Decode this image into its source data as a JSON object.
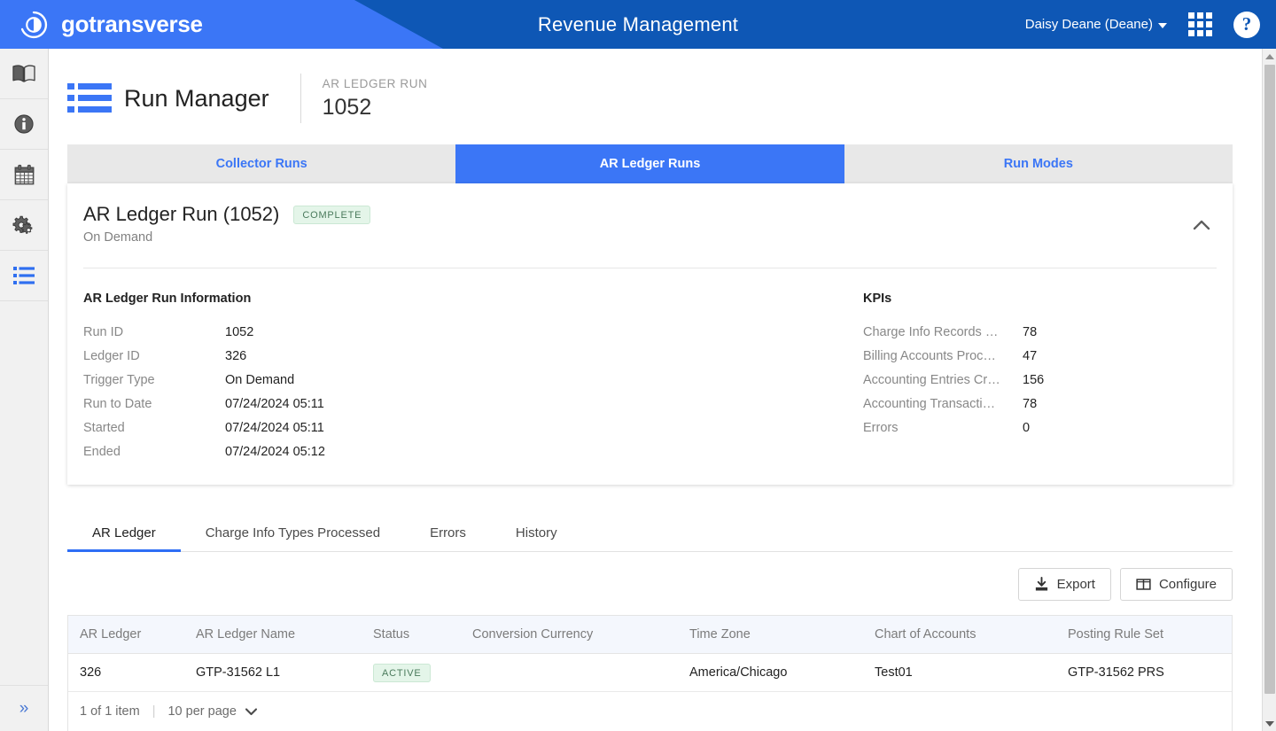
{
  "header": {
    "brand": "gotransverse",
    "app_title": "Revenue Management",
    "user": "Daisy Deane (Deane)",
    "apps_icon": "grid-apps-icon",
    "help_icon": "help-question-icon",
    "colors": {
      "light_blue": "#3b76f6",
      "dark_blue": "#0e57b5"
    }
  },
  "sidebar": {
    "items": [
      {
        "icon": "book-icon",
        "active": false
      },
      {
        "icon": "info-circle-icon",
        "active": false
      },
      {
        "icon": "calendar-icon",
        "active": false
      },
      {
        "icon": "gears-icon",
        "active": false
      },
      {
        "icon": "list-icon",
        "active": true
      }
    ],
    "expand_label": "»"
  },
  "page": {
    "icon": "run-manager-list-icon",
    "title": "Run Manager",
    "meta_label": "AR LEDGER RUN",
    "meta_value": "1052"
  },
  "top_tabs": [
    {
      "label": "Collector Runs",
      "active": false
    },
    {
      "label": "AR Ledger Runs",
      "active": true
    },
    {
      "label": "Run Modes",
      "active": false
    }
  ],
  "card": {
    "title": "AR Ledger Run (1052)",
    "badge": "COMPLETE",
    "subtitle": "On Demand",
    "collapse_icon": "chevron-up-icon",
    "info": {
      "section_title": "AR Ledger Run Information",
      "rows": [
        {
          "label": "Run ID",
          "value": "1052"
        },
        {
          "label": "Ledger ID",
          "value": "326"
        },
        {
          "label": "Trigger Type",
          "value": "On Demand"
        },
        {
          "label": "Run to Date",
          "value": "07/24/2024 05:11"
        },
        {
          "label": "Started",
          "value": "07/24/2024 05:11"
        },
        {
          "label": "Ended",
          "value": "07/24/2024 05:12"
        }
      ]
    },
    "kpis": {
      "section_title": "KPIs",
      "rows": [
        {
          "label": "Charge Info Records …",
          "value": "78"
        },
        {
          "label": "Billing Accounts Proc…",
          "value": "47"
        },
        {
          "label": "Accounting Entries Cr…",
          "value": "156"
        },
        {
          "label": "Accounting Transacti…",
          "value": "78"
        },
        {
          "label": "Errors",
          "value": "0"
        }
      ]
    }
  },
  "sub_tabs": [
    {
      "label": "AR Ledger",
      "active": true
    },
    {
      "label": "Charge Info Types Processed",
      "active": false
    },
    {
      "label": "Errors",
      "active": false
    },
    {
      "label": "History",
      "active": false
    }
  ],
  "toolbar": {
    "export_label": "Export",
    "export_icon": "download-icon",
    "configure_label": "Configure",
    "configure_icon": "columns-icon"
  },
  "table": {
    "columns": [
      "AR Ledger",
      "AR Ledger Name",
      "Status",
      "Conversion Currency",
      "Time Zone",
      "Chart of Accounts",
      "Posting Rule Set"
    ],
    "rows": [
      {
        "ar_ledger": "326",
        "ar_ledger_name": "GTP-31562 L1",
        "status": "ACTIVE",
        "conversion_currency": "",
        "time_zone": "America/Chicago",
        "chart_of_accounts": "Test01",
        "posting_rule_set": "GTP-31562 PRS"
      }
    ],
    "pager": {
      "count": "1 of 1 item",
      "separator": "|",
      "per_page": "10 per page",
      "chevron": "chevron-down-icon"
    }
  }
}
